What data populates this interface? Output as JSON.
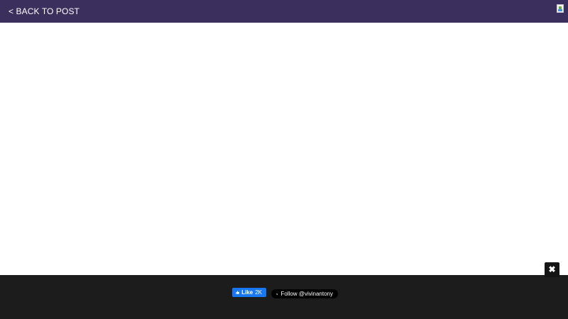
{
  "header": {
    "back_label": "< BACK TO POST",
    "image_icon": "broken-image-icon"
  },
  "overlay": {
    "close_glyph": "✖",
    "close_icon": "close-icon"
  },
  "footer": {
    "facebook": {
      "icon": "thumbs-up-icon",
      "label": "Like",
      "count": "2K"
    },
    "twitter": {
      "icon": "x-logo-icon",
      "label": "Follow @vivinantony"
    }
  },
  "colors": {
    "topbar": "#3b2f5e",
    "footer": "#1c1c1c",
    "facebook": "#1877f2",
    "twitter": "#000000"
  }
}
